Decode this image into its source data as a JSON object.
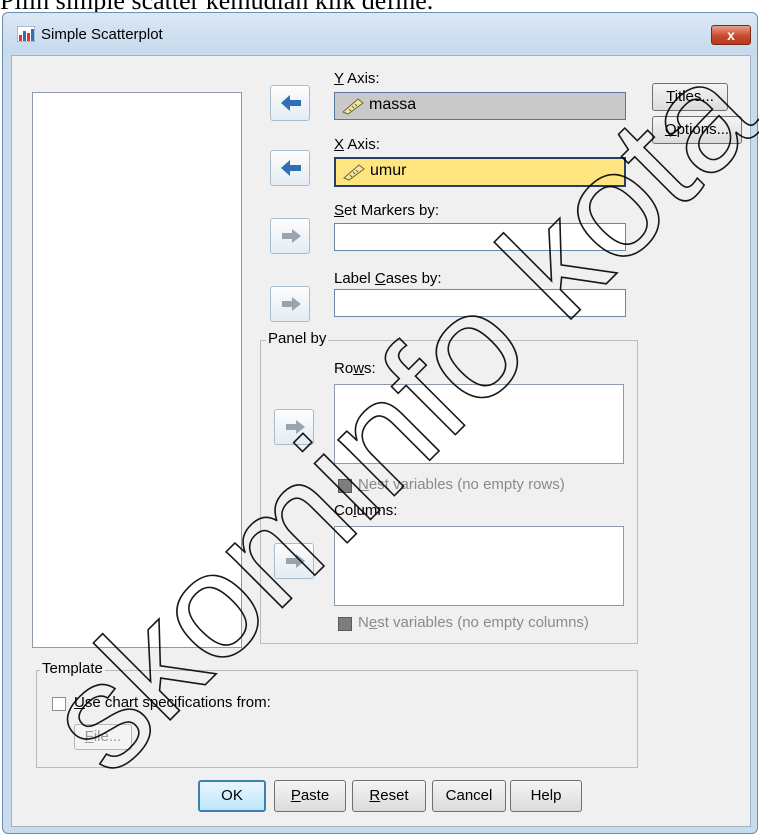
{
  "caption": "Pilih simple scatter kemudian klik define.",
  "window": {
    "title": "Simple Scatterplot",
    "close_label": "x"
  },
  "targets": {
    "y_axis": {
      "label": "Y Axis:",
      "value": "massa"
    },
    "x_axis": {
      "label": "X Axis:",
      "value": "umur"
    },
    "set_markers": {
      "label": "Set Markers by:",
      "value": ""
    },
    "label_cases": {
      "label": "Label Cases by:",
      "value": ""
    }
  },
  "panel_by": {
    "title": "Panel by",
    "rows_label": "Rows:",
    "rows_nest": "Nest variables (no empty rows)",
    "columns_label": "Columns:",
    "columns_nest": "Nest variables (no empty columns)"
  },
  "template": {
    "title": "Template",
    "use_chart_spec": "Use chart specifications from:",
    "file_button": "File..."
  },
  "side_buttons": {
    "titles": "Titles...",
    "options": "Options..."
  },
  "footer_buttons": {
    "ok": "OK",
    "paste": "Paste",
    "reset": "Reset",
    "cancel": "Cancel",
    "help": "Help"
  },
  "watermark": "skominfo kota",
  "colors": {
    "selected_field": "#ffe580",
    "filled_field": "#c9c9c9",
    "window_frame": "#c9dcee",
    "accent": "#2f6fb4"
  },
  "icons": {
    "app": "scatterplot-icon",
    "variable": "ruler-scale-icon",
    "arrow_active": "arrow-left-icon",
    "arrow_inactive": "arrow-right-icon"
  }
}
